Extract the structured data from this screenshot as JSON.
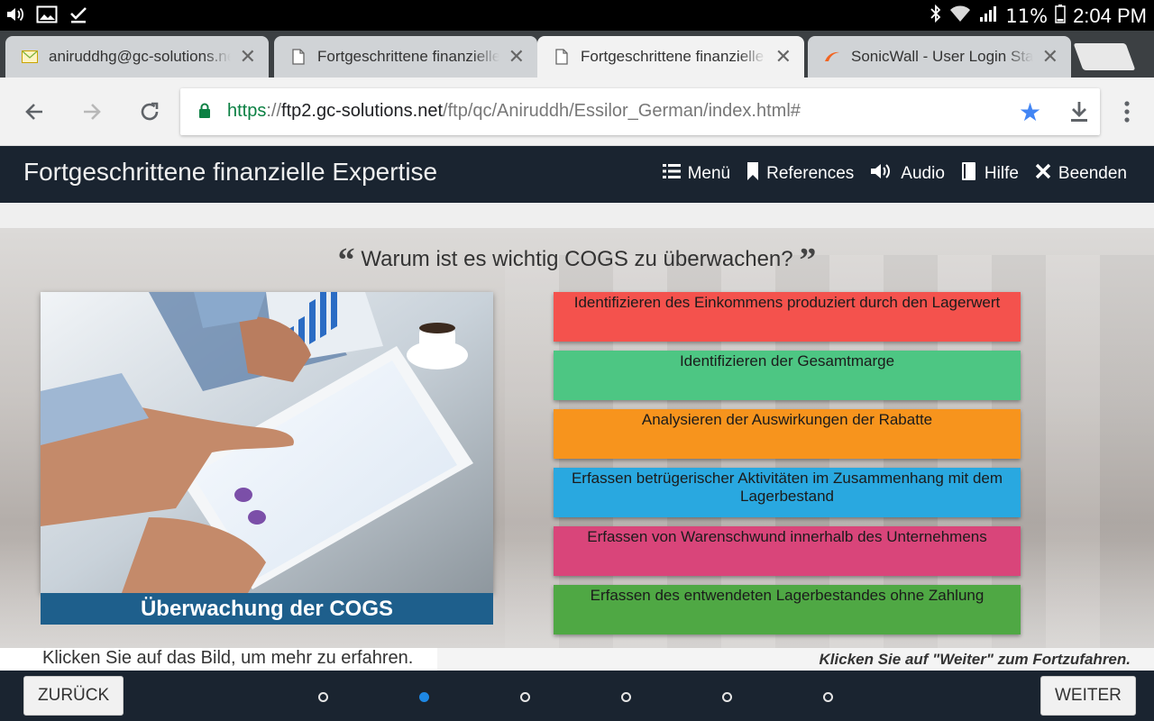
{
  "status_bar": {
    "battery": "11%",
    "time": "2:04 PM"
  },
  "tabs": [
    {
      "title": "aniruddhg@gc-solutions.ne",
      "icon": "mail-icon",
      "active": false
    },
    {
      "title": "Fortgeschrittene finanzielle",
      "icon": "page-icon",
      "active": false
    },
    {
      "title": "Fortgeschrittene finanzielle",
      "icon": "page-icon",
      "active": true
    },
    {
      "title": "SonicWall - User Login Statu",
      "icon": "sonicwall-icon",
      "active": false
    }
  ],
  "address_bar": {
    "scheme": "https",
    "separator": "://",
    "host": "ftp2.gc-solutions.net",
    "path": "/ftp/qc/Aniruddh/Essilor_German/index.html#"
  },
  "course": {
    "title": "Fortgeschrittene finanzielle Expertise",
    "nav": {
      "menu": "Menü",
      "references": "References",
      "audio": "Audio",
      "help": "Hilfe",
      "exit": "Beenden"
    }
  },
  "slide": {
    "question": "Warum ist es wichtig COGS zu überwachen?",
    "image_caption": "Überwachung der COGS",
    "answers": [
      {
        "text": "Identifizieren des Einkommens produziert durch den Lagerwert",
        "color": "#f4524d"
      },
      {
        "text": "Identifizieren der Gesamtmarge",
        "color": "#4dc683"
      },
      {
        "text": "Analysieren der Auswirkungen der Rabatte",
        "color": "#f7941d"
      },
      {
        "text": "Erfassen betrügerischer Aktivitäten im Zusammenhang mit dem Lagerbestand",
        "color": "#29a8e0"
      },
      {
        "text": "Erfassen von Warenschwund innerhalb des Unternehmens",
        "color": "#d9457a"
      },
      {
        "text": "Erfassen des entwendeten Lagerbestandes ohne Zahlung",
        "color": "#4fa844"
      }
    ],
    "instruction_left": "Klicken Sie auf das Bild, um mehr zu erfahren.",
    "instruction_right": "Klicken Sie auf \"Weiter\" zum Fortzufahren."
  },
  "footer": {
    "back_label": "ZURÜCK",
    "next_label": "WEITER",
    "page_count": 6,
    "current_page": 2
  }
}
